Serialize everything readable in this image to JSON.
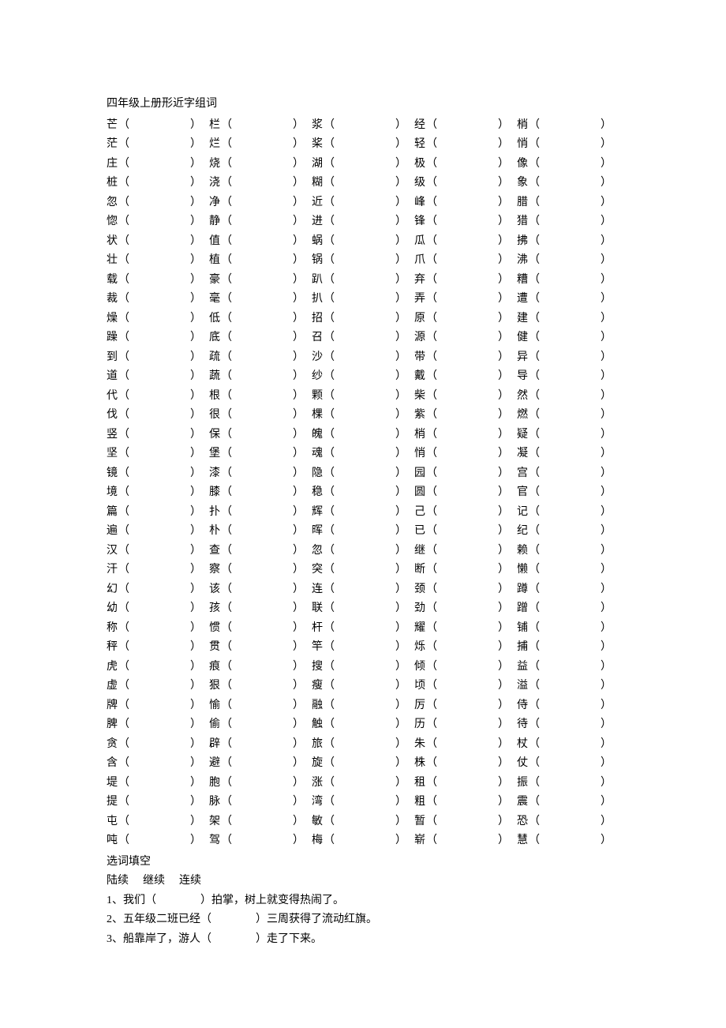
{
  "title": "四年级上册形近字组词",
  "rows": [
    [
      "芒",
      "栏",
      "浆",
      "经",
      "梢"
    ],
    [
      "茫",
      "烂",
      "桨",
      "轻",
      "悄"
    ],
    [
      "庄",
      "烧",
      "湖",
      "极",
      "像"
    ],
    [
      "桩",
      "浇",
      "糊",
      "级",
      "象"
    ],
    [
      "忽",
      "净",
      "近",
      "峰",
      "腊"
    ],
    [
      "惚",
      "静",
      "进",
      "锋",
      "猎"
    ],
    [
      "状",
      "值",
      "蜗",
      "瓜",
      "拂"
    ],
    [
      "壮",
      "植",
      "锅",
      "爪",
      "沸"
    ],
    [
      "载",
      "豪",
      "趴",
      "弃",
      "糟"
    ],
    [
      "裁",
      "毫",
      "扒",
      "弄",
      "遭"
    ],
    [
      "燥",
      "低",
      "招",
      "原",
      "建"
    ],
    [
      "躁",
      "底",
      "召",
      "源",
      "健"
    ],
    [
      "到",
      "疏",
      "沙",
      "带",
      "异"
    ],
    [
      "道",
      "蔬",
      "纱",
      "戴",
      "导"
    ],
    [
      "代",
      "根",
      "颗",
      "柴",
      "然"
    ],
    [
      "伐",
      "很",
      "棵",
      "紫",
      "燃"
    ],
    [
      "竖",
      "保",
      "魄",
      "梢",
      "疑"
    ],
    [
      "坚",
      "堡",
      "魂",
      "悄",
      "凝"
    ],
    [
      "镜",
      "漆",
      "隐",
      "园",
      "宫"
    ],
    [
      "境",
      "膝",
      "稳",
      "圆",
      "官"
    ],
    [
      "篇",
      "扑",
      "辉",
      "己",
      "记"
    ],
    [
      "遍",
      "朴",
      "晖",
      "已",
      "纪"
    ],
    [
      "汉",
      "查",
      "忽",
      "继",
      "赖"
    ],
    [
      "汗",
      "察",
      "突",
      "断",
      "懒"
    ],
    [
      "幻",
      "该",
      "连",
      "颈",
      "蹲"
    ],
    [
      "幼",
      "孩",
      "联",
      "劲",
      "蹭"
    ],
    [
      "称",
      "惯",
      "杆",
      "耀",
      "铺"
    ],
    [
      "秤",
      "贯",
      "竿",
      "烁",
      "捕"
    ],
    [
      "虎",
      "痕",
      "搜",
      "倾",
      "益"
    ],
    [
      "虚",
      "狠",
      "瘦",
      "顷",
      "溢"
    ],
    [
      "牌",
      "愉",
      "融",
      "厉",
      "侍"
    ],
    [
      "脾",
      "偷",
      "触",
      "历",
      "待"
    ],
    [
      "贪",
      "辟",
      "旅",
      "朱",
      "杖"
    ],
    [
      "含",
      "避",
      "旋",
      "株",
      "仗"
    ],
    [
      "堤",
      "胞",
      "涨",
      "租",
      "振"
    ],
    [
      "提",
      "脉",
      "湾",
      "粗",
      "震"
    ],
    [
      "屯",
      "架",
      "敏",
      "暂",
      "恐"
    ],
    [
      "吨",
      "驾",
      "梅",
      "崭",
      "慧"
    ]
  ],
  "fill": {
    "title": "选词填空",
    "words": [
      "陆续",
      "继续",
      "连续"
    ],
    "lines": [
      {
        "n": "1",
        "pre": "、我们（",
        "post": "）拍掌，树上就变得热闹了。"
      },
      {
        "n": "2",
        "pre": "、五年级二班已经（",
        "post": "）三周获得了流动红旗。"
      },
      {
        "n": "3",
        "pre": "、船靠岸了，游人（",
        "post": "）走了下来。"
      }
    ]
  }
}
